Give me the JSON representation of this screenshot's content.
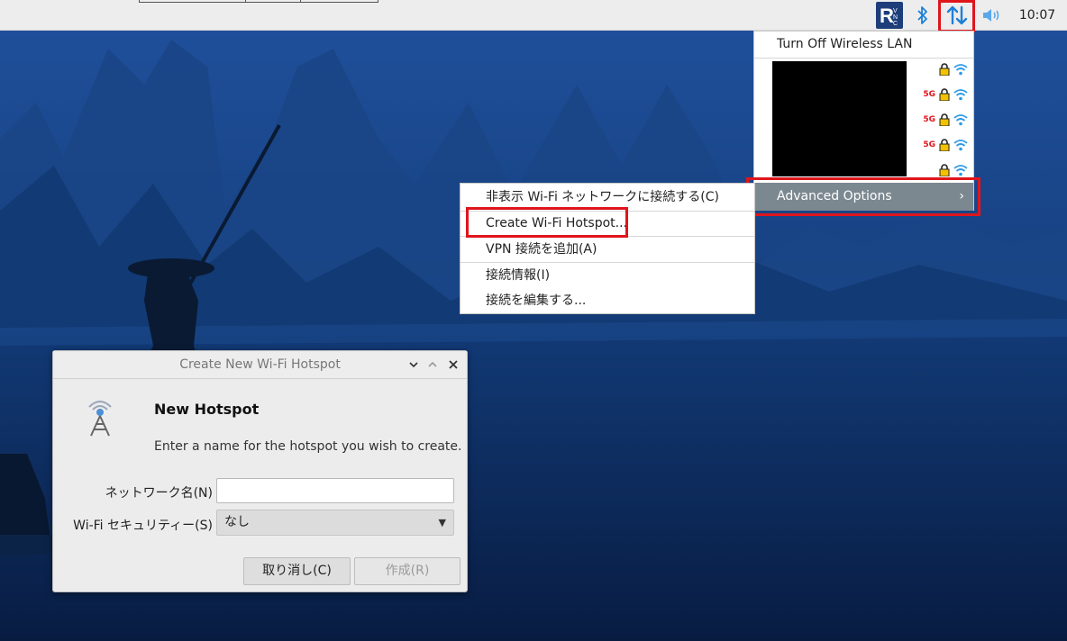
{
  "taskbar": {
    "clock": "10:07",
    "icons": [
      "vnc-icon",
      "bluetooth-icon",
      "network-arrows-icon",
      "volume-icon"
    ],
    "accent_highlight": "#e0151c"
  },
  "wifi_menu": {
    "turn_off": "Turn Off Wireless LAN",
    "networks": [
      {
        "band": "",
        "icons": [
          "lock-icon",
          "wifi-signal-icon"
        ]
      },
      {
        "band": "5G",
        "icons": [
          "lock-icon",
          "wifi-signal-icon"
        ]
      },
      {
        "band": "5G",
        "icons": [
          "lock-icon",
          "wifi-signal-icon"
        ]
      },
      {
        "band": "5G",
        "icons": [
          "lock-icon",
          "wifi-signal-icon"
        ]
      },
      {
        "band": "",
        "icons": [
          "lock-icon",
          "wifi-signal-icon"
        ]
      }
    ],
    "advanced_options": "Advanced Options",
    "advanced_arrow": "›"
  },
  "submenu": {
    "items": [
      "非表示 Wi-Fi ネットワークに接続する(C)",
      "Create Wi-Fi Hotspot...",
      "VPN 接続を追加(A)",
      "接続情報(I)",
      "接続を編集する..."
    ]
  },
  "dialog": {
    "title": "Create New Wi-Fi Hotspot",
    "heading": "New Hotspot",
    "message": "Enter a name for the hotspot you wish to create.",
    "network_name_label": "ネットワーク名(N)",
    "network_name_value": "",
    "security_label": "Wi-Fi セキュリティー(S)",
    "security_value": "なし",
    "cancel_label": "取り消し(C)",
    "create_label": "作成(R)"
  }
}
